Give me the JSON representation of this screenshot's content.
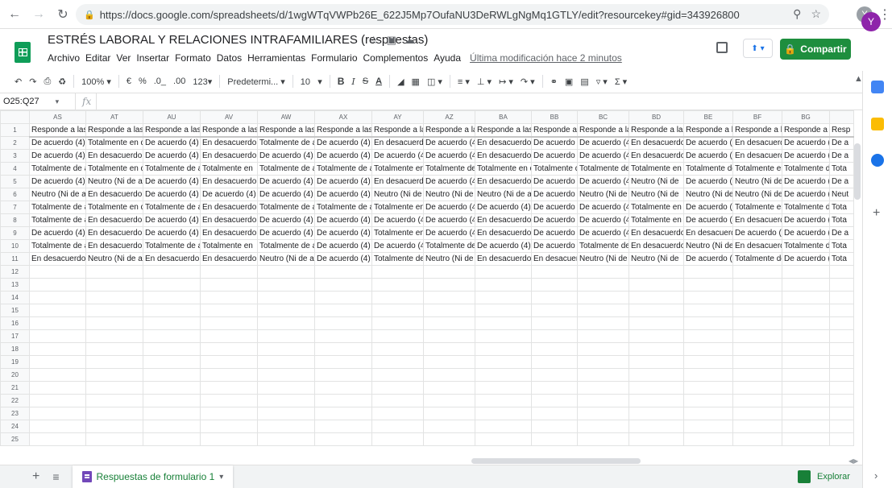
{
  "browser": {
    "url": "https://docs.google.com/spreadsheets/d/1wgWTqVWPb26E_622J5Mp7OufaNU3DeRWLgNgMq1GTLY/edit?resourcekey#gid=343926800",
    "profile_initial": "Y"
  },
  "doc": {
    "title": "ESTRÉS LABORAL Y RELACIONES INTRAFAMILIARES  (respuestas)",
    "menus": [
      "Archivo",
      "Editar",
      "Ver",
      "Insertar",
      "Formato",
      "Datos",
      "Herramientas",
      "Formulario",
      "Complementos",
      "Ayuda"
    ],
    "last_edit": "Última modificación hace 2 minutos",
    "share_label": "Compartir",
    "avatar_initial": "Y"
  },
  "toolbar": {
    "zoom": "100%",
    "currency": "€",
    "percent": "%",
    "dec_less": ".0_",
    "dec_more": ".00",
    "format_more": "123",
    "font": "Predetermi...",
    "font_size": "10",
    "bold": "B",
    "italic": "I",
    "strike": "S",
    "text_color": "A"
  },
  "formula": {
    "cell_ref": "O25:Q27",
    "fx": "fx"
  },
  "sheet": {
    "columns": [
      "AS",
      "AT",
      "AU",
      "AV",
      "AW",
      "AX",
      "AY",
      "AZ",
      "BA",
      "BB",
      "BC",
      "BD",
      "BE",
      "BF",
      "BG",
      ""
    ],
    "col_widths": [
      70,
      71,
      71,
      71,
      71,
      71,
      64,
      64,
      70,
      57,
      64,
      68,
      61,
      61,
      59,
      30
    ],
    "rows": [
      [
        "Responde a las",
        "Responde a las",
        "Responde a las",
        "Responde a las",
        "Responde a las",
        "Responde a las",
        "Responde a las",
        "Responde a las",
        "Responde a las",
        "Responde a l",
        "Responde a la",
        "Responde a la",
        "Responde a l",
        "Responde a la",
        "Responde a l",
        "Resp"
      ],
      [
        "De acuerdo (4)",
        "Totalmente en d",
        "De acuerdo (4)",
        "En desacuerdo",
        "Totalmente de a",
        "De acuerdo (4)",
        "En desacuerdo",
        "De acuerdo (4)",
        "En desacuerdo",
        "De acuerdo (",
        "De acuerdo (4",
        "En desacuerdo",
        "De acuerdo (4",
        "En desacuerd",
        "De acuerdo (",
        "De a"
      ],
      [
        "De acuerdo (4)",
        "En desacuerdo",
        "De acuerdo (4)",
        "En desacuerdo",
        "De acuerdo (4)",
        "De acuerdo (4)",
        "De acuerdo (4)",
        "De acuerdo (4)",
        "En desacuerdo",
        "De acuerdo (",
        "De acuerdo (4",
        "En desacuerdo",
        "De acuerdo (4",
        "En desacuerd",
        "De acuerdo (",
        "De a"
      ],
      [
        "Totalmente de a",
        "Totalmente en d",
        "Totalmente de a",
        "Totalmente en",
        "Totalmente de a",
        "Totalmente de a",
        "Totalmente en",
        "Totalmente de",
        "Totalmente en d",
        "Totalmente d",
        "Totalmente de",
        "Totalmente en",
        "Totalmente de",
        "Totalmente en",
        "Totalmente d",
        "Tota"
      ],
      [
        "De acuerdo (4)",
        "Neutro (Ni de ac",
        "De acuerdo (4)",
        "En desacuerdo",
        "De acuerdo (4)",
        "De acuerdo (4)",
        "En desacuerdo",
        "De acuerdo (4)",
        "En desacuerdo",
        "De acuerdo (",
        "De acuerdo (4",
        "Neutro (Ni de",
        "De acuerdo (4",
        "Neutro (Ni de",
        "De acuerdo (",
        "De a"
      ],
      [
        "Neutro (Ni de ac",
        "En desacuerdo",
        "De acuerdo (4)",
        "De acuerdo (4)",
        "De acuerdo (4)",
        "De acuerdo (4)",
        "Neutro (Ni de a",
        "Neutro (Ni de a",
        "Neutro (Ni de ac",
        "De acuerdo (",
        "Neutro (Ni de",
        "Neutro (Ni de",
        "Neutro (Ni de",
        "Neutro (Ni de",
        "De acuerdo (",
        "Neut"
      ],
      [
        "Totalmente de a",
        "Totalmente en d",
        "Totalmente de a",
        "En desacuerdo",
        "Totalmente de a",
        "Totalmente de a",
        "Totalmente en",
        "De acuerdo (4)",
        "De acuerdo (4)",
        "De acuerdo (",
        "De acuerdo (4",
        "Totalmente en",
        "De acuerdo (4",
        "Totalmente en",
        "Totalmente d",
        "Tota"
      ],
      [
        "Totalmente de a",
        "En desacuerdo",
        "De acuerdo (4)",
        "En desacuerdo",
        "De acuerdo (4)",
        "De acuerdo (4)",
        "De acuerdo (4)",
        "De acuerdo (4)",
        "En desacuerdo",
        "De acuerdo (",
        "De acuerdo (4",
        "Totalmente en",
        "De acuerdo (4",
        "En desacuerd",
        "De acuerdo (",
        "Tota"
      ],
      [
        "De acuerdo (4)",
        "En desacuerdo",
        "De acuerdo (4)",
        "En desacuerdo",
        "De acuerdo (4)",
        "De acuerdo (4)",
        "Totalmente en",
        "De acuerdo (4)",
        "En desacuerdo",
        "De acuerdo (",
        "De acuerdo (4",
        "En desacuerdo",
        "En desacuerd",
        "De acuerdo (4",
        "De acuerdo (",
        "De a"
      ],
      [
        "Totalmente de a",
        "En desacuerdo",
        "Totalmente de a",
        "Totalmente en",
        "Totalmente de a",
        "De acuerdo (4)",
        "De acuerdo (4)",
        "Totalmente de",
        "De acuerdo (4)",
        "De acuerdo (",
        "Totalmente de",
        "En desacuerdo",
        "Neutro (Ni de",
        "En desacuerd",
        "Totalmente d",
        "Tota"
      ],
      [
        "En desacuerdo",
        "Neutro (Ni de ac",
        "En desacuerdo",
        "En desacuerdo",
        "Neutro (Ni de ac",
        "De acuerdo (4)",
        "Totalmente de",
        "Neutro (Ni de a",
        "En desacuerdo",
        "En desacuerd",
        "Neutro (Ni de",
        "Neutro (Ni de",
        "De acuerdo (4",
        "Totalmente de",
        "De acuerdo (",
        "Tota"
      ]
    ],
    "row_numbers": [
      "1",
      "2",
      "3",
      "4",
      "5",
      "6",
      "7",
      "8",
      "9",
      "10",
      "11",
      "12",
      "13",
      "14",
      "15",
      "16",
      "17",
      "18",
      "19",
      "20",
      "21",
      "22",
      "23",
      "24",
      "25"
    ]
  },
  "bottom": {
    "sheet_tab": "Respuestas de formulario 1",
    "explore": "Explorar"
  },
  "colors": {
    "share_green": "#1e8e3e",
    "sheets_green": "#0f9d58",
    "avatar_purple": "#8e24aa",
    "form_purple": "#7248b9"
  }
}
